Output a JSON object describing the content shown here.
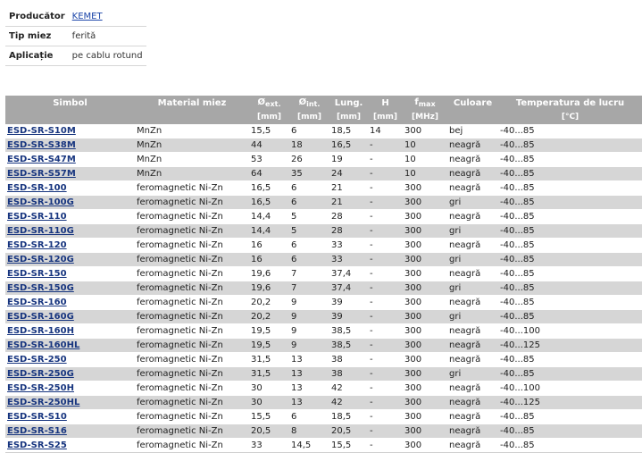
{
  "info": [
    {
      "label": "Producător",
      "value": "KEMET",
      "link": true
    },
    {
      "label": "Tip miez",
      "value": "ferită",
      "link": false
    },
    {
      "label": "Aplicație",
      "value": "pe cablu rotund",
      "link": false
    }
  ],
  "table": {
    "headers": {
      "symbol": "Simbol",
      "material": "Material miez",
      "dext": "Ø",
      "dext_sub": "ext.",
      "dext_unit": "[mm]",
      "dint": "Ø",
      "dint_sub": "int.",
      "dint_unit": "[mm]",
      "length": "Lung.",
      "length_unit": "[mm]",
      "h": "H",
      "h_unit": "[mm]",
      "fmax": "f",
      "fmax_sub": "max",
      "fmax_unit": "[MHz]",
      "color": "Culoare",
      "temp": "Temperatura de lucru",
      "temp_unit": "[°C]"
    },
    "rows": [
      {
        "symbol": "ESD-SR-S10M",
        "material": "MnZn",
        "dext": "15,5",
        "dint": "6",
        "length": "18,5",
        "h": "14",
        "fmax": "300",
        "color": "bej",
        "temp": "-40...85"
      },
      {
        "symbol": "ESD-SR-S38M",
        "material": "MnZn",
        "dext": "44",
        "dint": "18",
        "length": "16,5",
        "h": "-",
        "fmax": "10",
        "color": "neagră",
        "temp": "-40...85"
      },
      {
        "symbol": "ESD-SR-S47M",
        "material": "MnZn",
        "dext": "53",
        "dint": "26",
        "length": "19",
        "h": "-",
        "fmax": "10",
        "color": "neagră",
        "temp": "-40...85"
      },
      {
        "symbol": "ESD-SR-S57M",
        "material": "MnZn",
        "dext": "64",
        "dint": "35",
        "length": "24",
        "h": "-",
        "fmax": "10",
        "color": "neagră",
        "temp": "-40...85"
      },
      {
        "symbol": "ESD-SR-100",
        "material": "feromagnetic Ni-Zn",
        "dext": "16,5",
        "dint": "6",
        "length": "21",
        "h": "-",
        "fmax": "300",
        "color": "neagră",
        "temp": "-40...85"
      },
      {
        "symbol": "ESD-SR-100G",
        "material": "feromagnetic Ni-Zn",
        "dext": "16,5",
        "dint": "6",
        "length": "21",
        "h": "-",
        "fmax": "300",
        "color": "gri",
        "temp": "-40...85"
      },
      {
        "symbol": "ESD-SR-110",
        "material": "feromagnetic Ni-Zn",
        "dext": "14,4",
        "dint": "5",
        "length": "28",
        "h": "-",
        "fmax": "300",
        "color": "neagră",
        "temp": "-40...85"
      },
      {
        "symbol": "ESD-SR-110G",
        "material": "feromagnetic Ni-Zn",
        "dext": "14,4",
        "dint": "5",
        "length": "28",
        "h": "-",
        "fmax": "300",
        "color": "gri",
        "temp": "-40...85"
      },
      {
        "symbol": "ESD-SR-120",
        "material": "feromagnetic Ni-Zn",
        "dext": "16",
        "dint": "6",
        "length": "33",
        "h": "-",
        "fmax": "300",
        "color": "neagră",
        "temp": "-40...85"
      },
      {
        "symbol": "ESD-SR-120G",
        "material": "feromagnetic Ni-Zn",
        "dext": "16",
        "dint": "6",
        "length": "33",
        "h": "-",
        "fmax": "300",
        "color": "gri",
        "temp": "-40...85"
      },
      {
        "symbol": "ESD-SR-150",
        "material": "feromagnetic Ni-Zn",
        "dext": "19,6",
        "dint": "7",
        "length": "37,4",
        "h": "-",
        "fmax": "300",
        "color": "neagră",
        "temp": "-40...85"
      },
      {
        "symbol": "ESD-SR-150G",
        "material": "feromagnetic Ni-Zn",
        "dext": "19,6",
        "dint": "7",
        "length": "37,4",
        "h": "-",
        "fmax": "300",
        "color": "gri",
        "temp": "-40...85"
      },
      {
        "symbol": "ESD-SR-160",
        "material": "feromagnetic Ni-Zn",
        "dext": "20,2",
        "dint": "9",
        "length": "39",
        "h": "-",
        "fmax": "300",
        "color": "neagră",
        "temp": "-40...85"
      },
      {
        "symbol": "ESD-SR-160G",
        "material": "feromagnetic Ni-Zn",
        "dext": "20,2",
        "dint": "9",
        "length": "39",
        "h": "-",
        "fmax": "300",
        "color": "gri",
        "temp": "-40...85"
      },
      {
        "symbol": "ESD-SR-160H",
        "material": "feromagnetic Ni-Zn",
        "dext": "19,5",
        "dint": "9",
        "length": "38,5",
        "h": "-",
        "fmax": "300",
        "color": "neagră",
        "temp": "-40...100"
      },
      {
        "symbol": "ESD-SR-160HL",
        "material": "feromagnetic Ni-Zn",
        "dext": "19,5",
        "dint": "9",
        "length": "38,5",
        "h": "-",
        "fmax": "300",
        "color": "neagră",
        "temp": "-40...125"
      },
      {
        "symbol": "ESD-SR-250",
        "material": "feromagnetic Ni-Zn",
        "dext": "31,5",
        "dint": "13",
        "length": "38",
        "h": "-",
        "fmax": "300",
        "color": "neagră",
        "temp": "-40...85"
      },
      {
        "symbol": "ESD-SR-250G",
        "material": "feromagnetic Ni-Zn",
        "dext": "31,5",
        "dint": "13",
        "length": "38",
        "h": "-",
        "fmax": "300",
        "color": "gri",
        "temp": "-40...85"
      },
      {
        "symbol": "ESD-SR-250H",
        "material": "feromagnetic Ni-Zn",
        "dext": "30",
        "dint": "13",
        "length": "42",
        "h": "-",
        "fmax": "300",
        "color": "neagră",
        "temp": "-40...100"
      },
      {
        "symbol": "ESD-SR-250HL",
        "material": "feromagnetic Ni-Zn",
        "dext": "30",
        "dint": "13",
        "length": "42",
        "h": "-",
        "fmax": "300",
        "color": "neagră",
        "temp": "-40...125"
      },
      {
        "symbol": "ESD-SR-S10",
        "material": "feromagnetic Ni-Zn",
        "dext": "15,5",
        "dint": "6",
        "length": "18,5",
        "h": "-",
        "fmax": "300",
        "color": "neagră",
        "temp": "-40...85"
      },
      {
        "symbol": "ESD-SR-S16",
        "material": "feromagnetic Ni-Zn",
        "dext": "20,5",
        "dint": "8",
        "length": "20,5",
        "h": "-",
        "fmax": "300",
        "color": "neagră",
        "temp": "-40...85"
      },
      {
        "symbol": "ESD-SR-S25",
        "material": "feromagnetic Ni-Zn",
        "dext": "33",
        "dint": "14,5",
        "length": "15,5",
        "h": "-",
        "fmax": "300",
        "color": "neagră",
        "temp": "-40...85"
      }
    ]
  },
  "colors": {
    "header_bg": "#a7a7a7",
    "row_alt_bg": "#d6d6d6",
    "link": "#17357f"
  }
}
